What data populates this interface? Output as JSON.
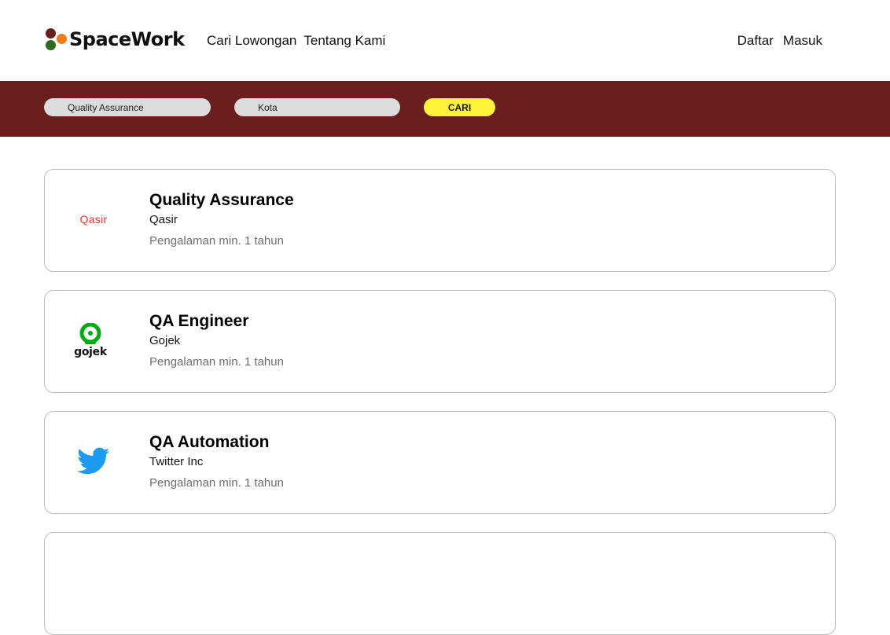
{
  "nav": {
    "brand": "SpaceWork",
    "links": [
      "Cari Lowongan",
      "Tentang Kami"
    ],
    "auth": [
      "Daftar",
      "Masuk"
    ]
  },
  "search": {
    "keyword_value": "Quality Assurance",
    "city_placeholder": "Kota",
    "button_label": "CARI"
  },
  "colors": {
    "brand_maroon": "#6b1e1e",
    "brand_orange": "#f07a1d",
    "brand_green": "#2f6b1f",
    "accent_yellow": "#fff23a",
    "qasir_red": "#e8382a",
    "gojek_green": "#00aa13",
    "twitter_blue": "#1d9bf0"
  },
  "jobs": [
    {
      "title": "Quality Assurance",
      "company": "Qasir",
      "experience": "Pengalaman min. 1 tahun",
      "logo_text": "Qasir",
      "logo_icon": "qasir-logo"
    },
    {
      "title": "QA Engineer",
      "company": "Gojek",
      "experience": "Pengalaman min. 1 tahun",
      "logo_text": "gojek",
      "logo_icon": "gojek-logo"
    },
    {
      "title": "QA Automation",
      "company": "Twitter Inc",
      "experience": "Pengalaman min. 1 tahun",
      "logo_icon": "twitter-bird-icon"
    }
  ]
}
